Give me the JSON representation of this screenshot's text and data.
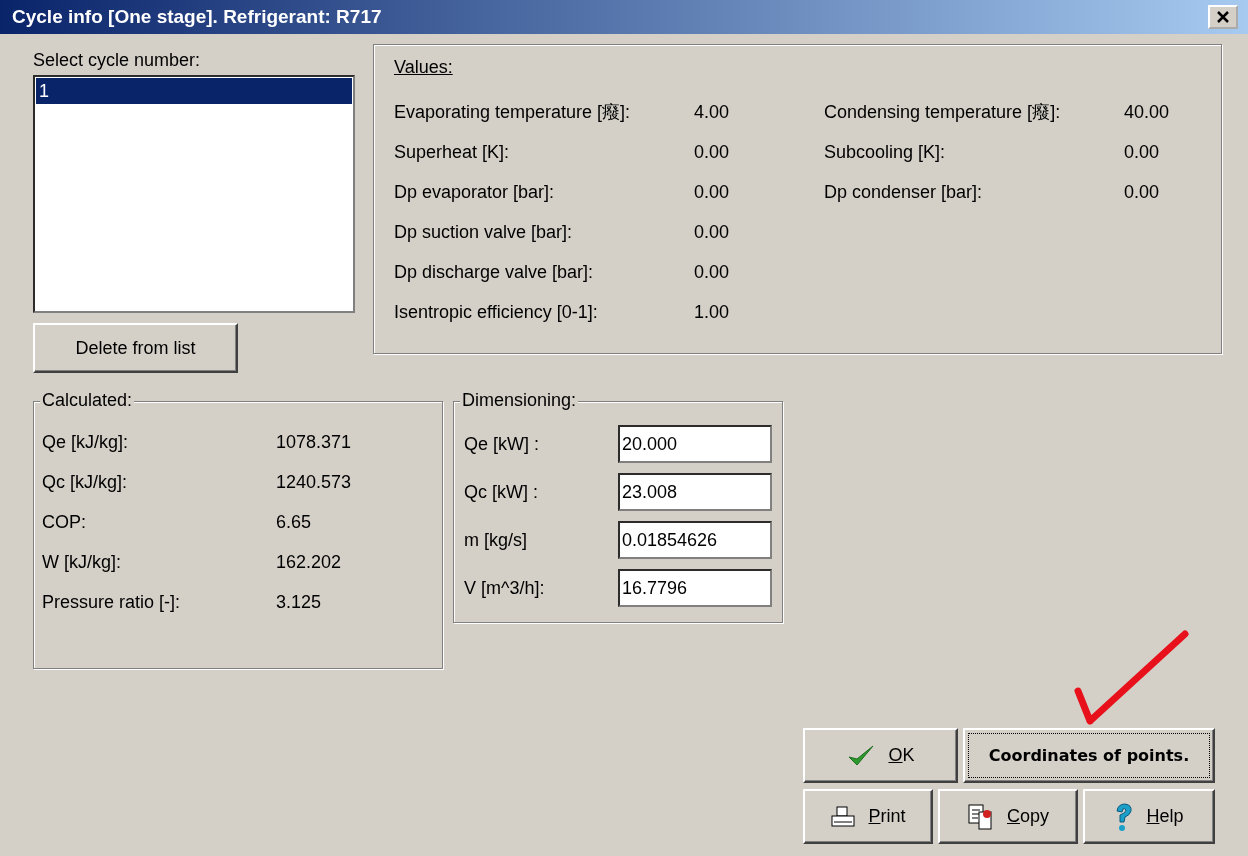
{
  "window": {
    "title": "Cycle info [One stage]. Refrigerant: R717"
  },
  "cycle_list": {
    "label": "Select cycle number:",
    "items": [
      {
        "text": "1",
        "selected": true
      }
    ]
  },
  "delete_button": "Delete from list",
  "values": {
    "title": "Values:",
    "left": [
      {
        "label": "Evaporating temperature [癈]:",
        "value": "4.00"
      },
      {
        "label": "Superheat [K]:",
        "value": "0.00"
      },
      {
        "label": "Dp evaporator [bar]:",
        "value": "0.00"
      },
      {
        "label": "Dp suction valve [bar]:",
        "value": "0.00"
      },
      {
        "label": "Dp discharge valve [bar]:",
        "value": "0.00"
      },
      {
        "label": "Isentropic efficiency [0-1]:",
        "value": "1.00"
      }
    ],
    "right": [
      {
        "label": "Condensing temperature [癈]:",
        "value": "40.00"
      },
      {
        "label": "Subcooling [K]:",
        "value": "0.00"
      },
      {
        "label": "Dp condenser [bar]:",
        "value": "0.00"
      }
    ]
  },
  "calculated": {
    "title": "Calculated:",
    "rows": [
      {
        "label": "Qe [kJ/kg]:",
        "value": "1078.371"
      },
      {
        "label": "Qc [kJ/kg]:",
        "value": "1240.573"
      },
      {
        "label": "COP:",
        "value": "6.65"
      },
      {
        "label": "W [kJ/kg]:",
        "value": "162.202"
      },
      {
        "label": "Pressure ratio [-]:",
        "value": "3.125"
      }
    ]
  },
  "dimensioning": {
    "title": "Dimensioning:",
    "fields": [
      {
        "label": "Qe [kW] :",
        "value": "20.000"
      },
      {
        "label": "Qc [kW] :",
        "value": "23.008"
      },
      {
        "label": "m [kg/s]",
        "value": "0.01854626"
      },
      {
        "label": "V [m^3/h]:",
        "value": "16.7796"
      }
    ]
  },
  "buttons": [
    {
      "kind": "ok",
      "label": "OK",
      "underline_first": true,
      "focused": false
    },
    {
      "kind": "coordinates",
      "label": "Coordinates of points.",
      "underline_first": false,
      "focused": true
    },
    {
      "kind": "print",
      "label": "Print",
      "underline_first": true,
      "focused": false
    },
    {
      "kind": "copy",
      "label": "Copy",
      "underline_first": true,
      "focused": false
    },
    {
      "kind": "help",
      "label": "Help",
      "underline_first": true,
      "focused": false
    }
  ]
}
